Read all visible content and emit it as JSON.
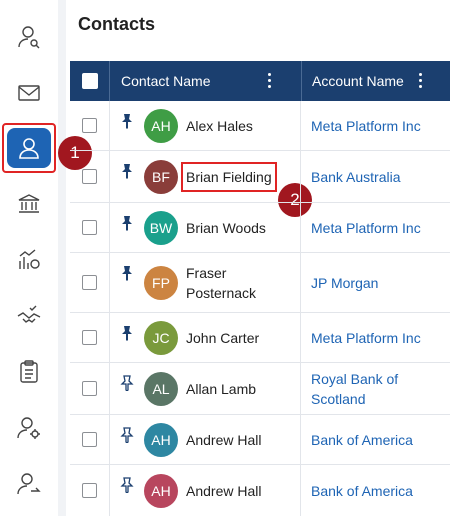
{
  "page": {
    "title": "Contacts"
  },
  "nav": {
    "items": [
      {
        "icon": "user-search-icon"
      },
      {
        "icon": "mail-icon"
      },
      {
        "icon": "contact-icon"
      },
      {
        "icon": "bank-icon"
      },
      {
        "icon": "analytics-icon"
      },
      {
        "icon": "handshake-icon"
      },
      {
        "icon": "clipboard-icon"
      },
      {
        "icon": "user-settings-icon"
      },
      {
        "icon": "user-share-icon"
      }
    ],
    "active_index": 2
  },
  "callouts": {
    "first": "1",
    "second": "2"
  },
  "grid": {
    "columns": {
      "contact_name": "Contact Name",
      "account_name": "Account Name"
    },
    "rows": [
      {
        "initials": "AH",
        "avatar_color": "#3f9d45",
        "name": "Alex Hales",
        "account": "Meta Platform Inc",
        "pinned": true
      },
      {
        "initials": "BF",
        "avatar_color": "#8a3d3a",
        "name": "Brian Fielding",
        "account": "Bank Australia",
        "pinned": true
      },
      {
        "initials": "BW",
        "avatar_color": "#1aa08c",
        "name": "Brian Woods",
        "account": "Meta Platform Inc",
        "pinned": true
      },
      {
        "initials": "FP",
        "avatar_color": "#cc8441",
        "name": "Fraser Posternack",
        "account": "JP Morgan",
        "pinned": true
      },
      {
        "initials": "JC",
        "avatar_color": "#7a9a3c",
        "name": "John Carter",
        "account": "Meta Platform Inc",
        "pinned": true
      },
      {
        "initials": "AL",
        "avatar_color": "#5a7666",
        "name": "Allan Lamb",
        "account": "Royal Bank of Scotland",
        "pinned": false
      },
      {
        "initials": "AH",
        "avatar_color": "#2e87a2",
        "name": "Andrew Hall",
        "account": "Bank of America",
        "pinned": false
      },
      {
        "initials": "AH",
        "avatar_color": "#b8465e",
        "name": "Andrew Hall",
        "account": "Bank of America",
        "pinned": false
      }
    ]
  },
  "colors": {
    "accent": "#1e64b4",
    "header": "#1b3f6f",
    "highlight": "#e02424",
    "callout": "#a1171f"
  }
}
